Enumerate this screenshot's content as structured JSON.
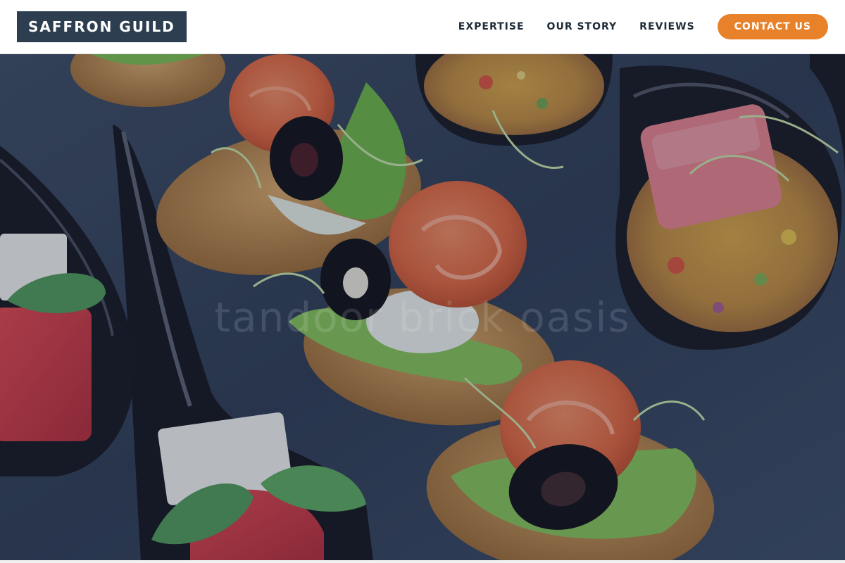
{
  "header": {
    "logo_text": "SAFFRON GUILD",
    "nav_items": [
      {
        "label": "EXPERTISE"
      },
      {
        "label": "OUR STORY"
      },
      {
        "label": "REVIEWS"
      }
    ],
    "cta_label": "CONTACT US"
  },
  "hero": {
    "tagline": "tandoor brick oasis",
    "image_subject": "catering canapes on slate: salmon rose crostini, olives, microgreens, tartare spoons, watermelon and feta"
  },
  "colors": {
    "logo_bg": "#2d3e50",
    "cta_bg": "#e8822a",
    "nav_text": "#1e2b38",
    "hero_overlay": "#1c2846"
  }
}
